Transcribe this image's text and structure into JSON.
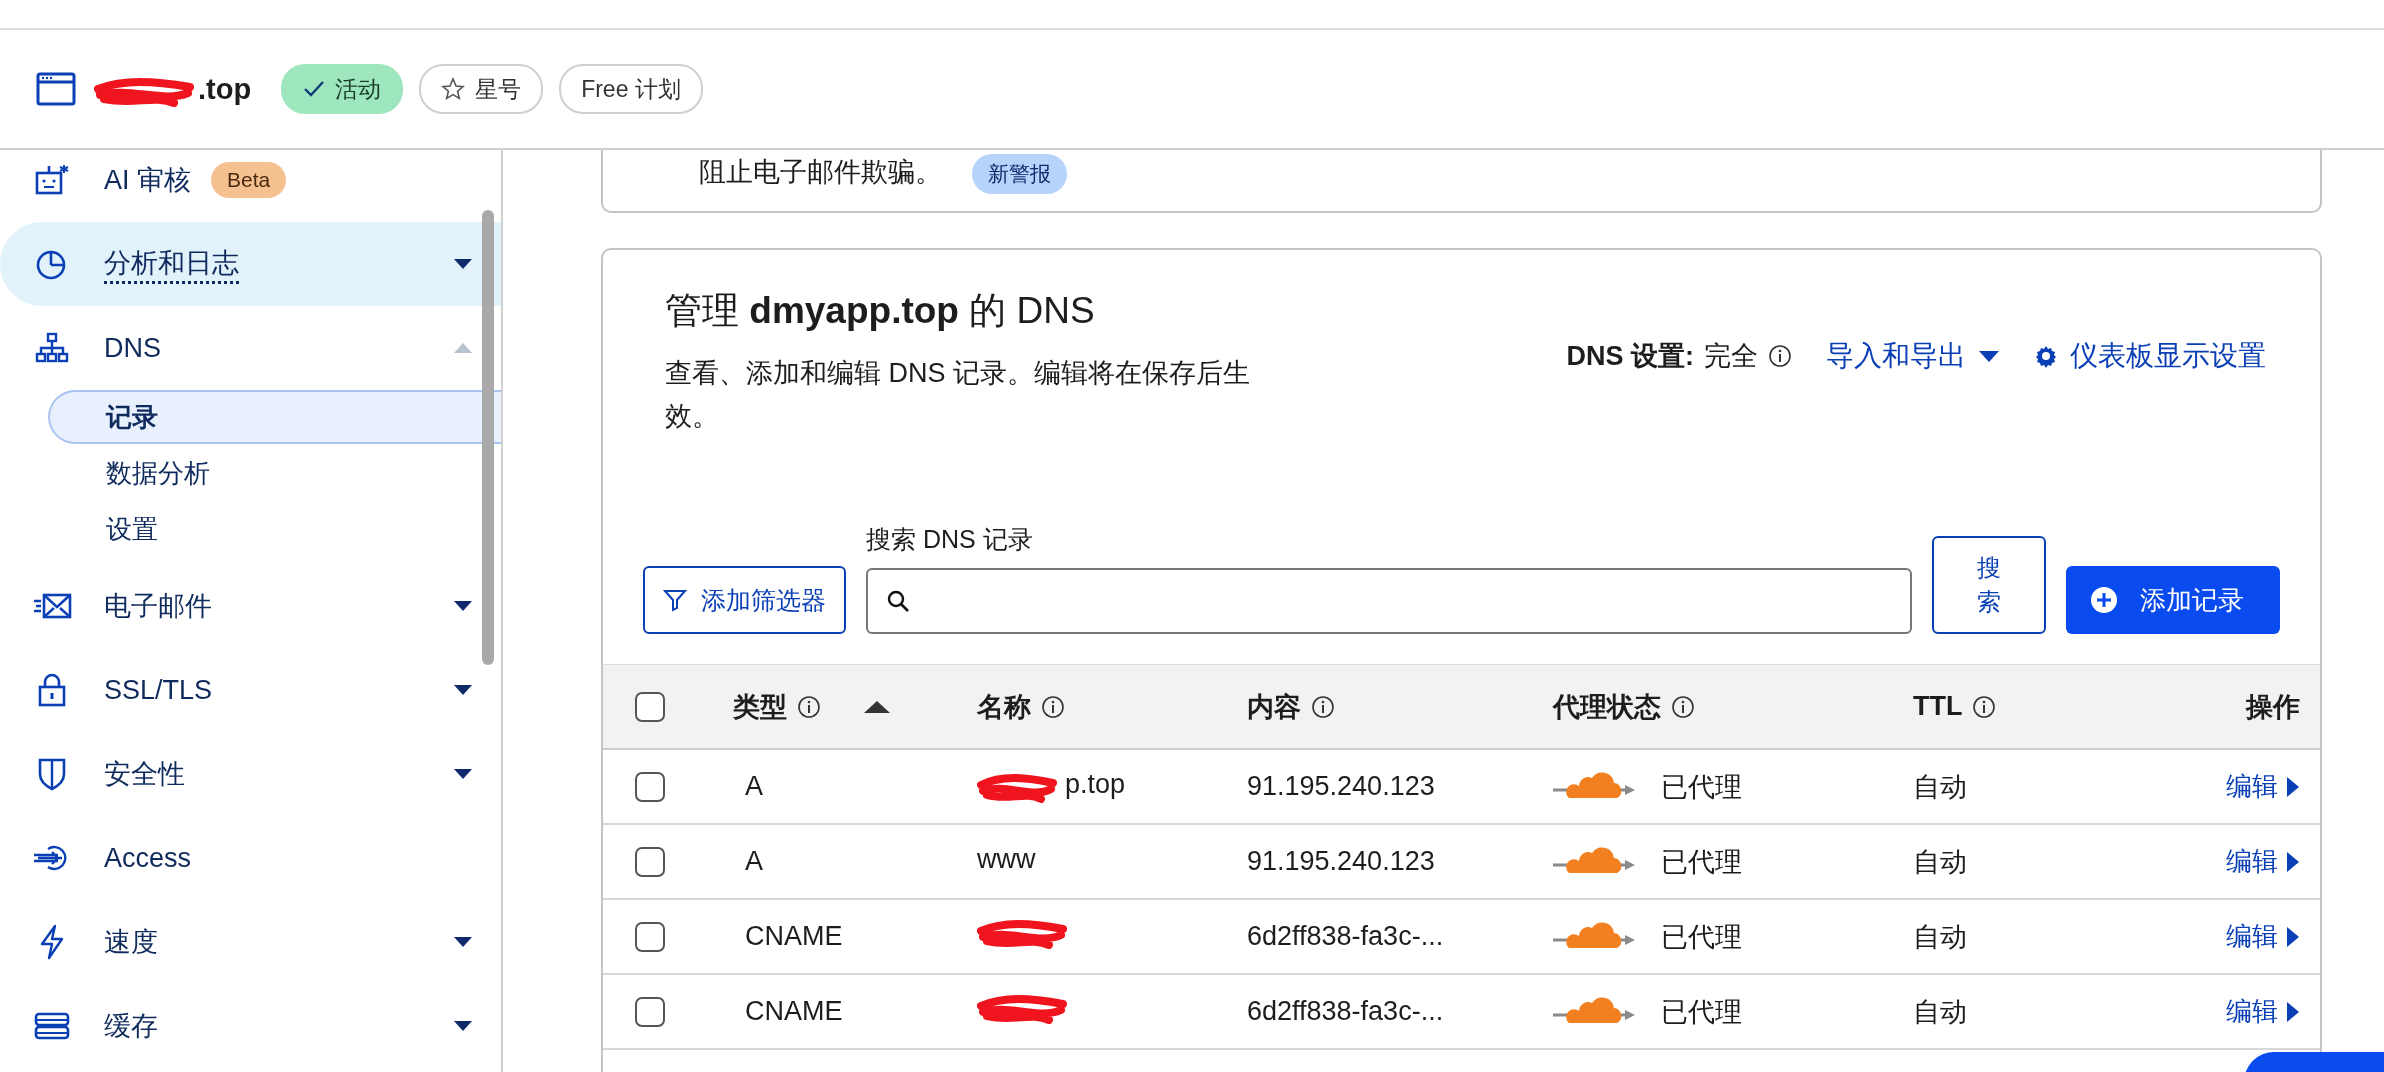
{
  "header": {
    "domain": ".top",
    "domain_redacted": true,
    "badges": [
      {
        "kind": "status",
        "label": "活动"
      },
      {
        "kind": "star",
        "label": "星号"
      },
      {
        "kind": "plan",
        "label": "Free 计划"
      }
    ]
  },
  "sidebar": {
    "items": [
      {
        "label": "AI 审核",
        "badge": "Beta",
        "hovered": false
      },
      {
        "label": "分析和日志",
        "hovered": true,
        "expanded": false
      },
      {
        "label": "DNS",
        "hovered": false,
        "expanded": true,
        "children": [
          {
            "label": "记录",
            "selected": true
          },
          {
            "label": "数据分析",
            "selected": false
          },
          {
            "label": "设置",
            "selected": false
          }
        ]
      },
      {
        "label": "电子邮件",
        "hovered": false,
        "expanded": false
      },
      {
        "label": "SSL/TLS",
        "hovered": false,
        "expanded": false
      },
      {
        "label": "安全性",
        "hovered": false,
        "expanded": false
      },
      {
        "label": "Access",
        "hovered": false
      },
      {
        "label": "速度",
        "hovered": false,
        "expanded": false
      },
      {
        "label": "缓存",
        "hovered": false,
        "expanded": false
      }
    ]
  },
  "alert_card": {
    "text": "阻止电子邮件欺骗。",
    "badge": "新警报"
  },
  "dns": {
    "title": "管理 **dmyapp.top** 的 DNS",
    "description": "查看、添加和编辑 DNS 记录。编辑将在保存后生效。",
    "setting_label": "DNS 设置:",
    "setting_value": "完全",
    "import_export": "导入和导出",
    "dashboard_settings": "仪表板显示设置",
    "filter_button": "添加筛选器",
    "search_label": "搜索 DNS 记录",
    "search_button": "搜索",
    "add_button": "添加记录",
    "columns": [
      {
        "label": "类型",
        "info": true,
        "sorted": true
      },
      {
        "label": "名称",
        "info": true,
        "sorted": false
      },
      {
        "label": "内容",
        "info": true,
        "sorted": false
      },
      {
        "label": "代理状态",
        "info": true,
        "sorted": false
      },
      {
        "label": "TTL",
        "info": true,
        "sorted": false
      },
      {
        "label": "操作",
        "info": false,
        "sorted": false
      }
    ],
    "select_all_checked": false,
    "rows": [
      {
        "checked": false,
        "type": "A",
        "name": "p.top",
        "name_redacted": true,
        "content": "91.195.240.123",
        "proxied": true,
        "proxy": "已代理",
        "ttl": "自动",
        "action": "编辑"
      },
      {
        "checked": false,
        "type": "A",
        "name": "www",
        "name_redacted": false,
        "content": "91.195.240.123",
        "proxied": true,
        "proxy": "已代理",
        "ttl": "自动",
        "action": "编辑"
      },
      {
        "checked": false,
        "type": "CNAME",
        "name_redacted": true,
        "content": "6d2ff838-fa3c-...",
        "proxied": true,
        "proxy": "已代理",
        "ttl": "自动",
        "action": "编辑"
      },
      {
        "checked": false,
        "type": "CNAME",
        "name_redacted": true,
        "content": "6d2ff838-fa3c-...",
        "proxied": true,
        "proxy": "已代理",
        "ttl": "自动",
        "action": "编辑"
      }
    ]
  }
}
